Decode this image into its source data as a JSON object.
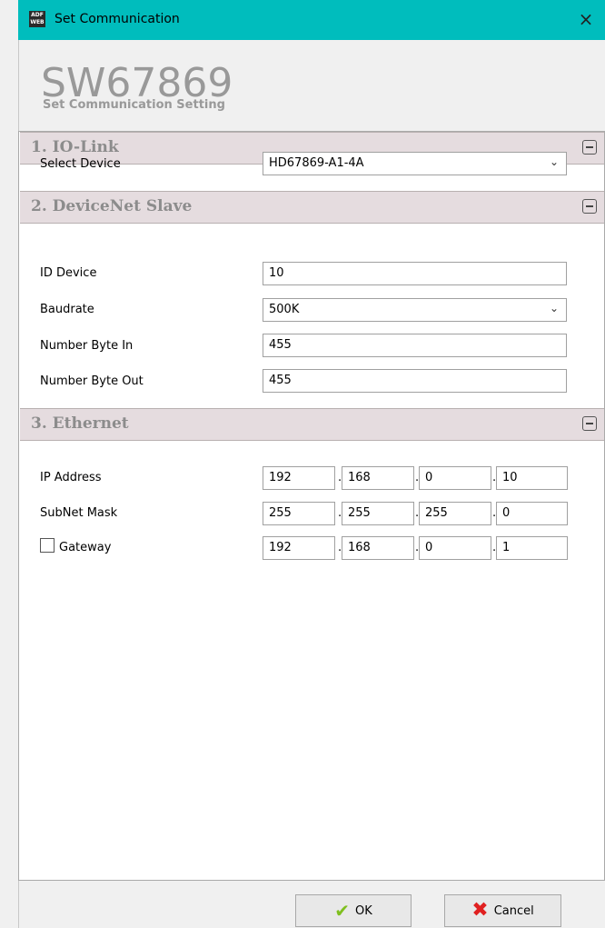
{
  "window": {
    "icon_text": "ADF WEB",
    "title": "Set Communication",
    "close": "×"
  },
  "header": {
    "model": "SW67869",
    "subtitle": "Set Communication Setting"
  },
  "sections": {
    "io_link": {
      "title": "1. IO-Link",
      "select_device_label": "Select Device",
      "select_device_value": "HD67869-A1-4A"
    },
    "devicenet": {
      "title": "2. DeviceNet Slave",
      "id_device_label": "ID Device",
      "id_device_value": "10",
      "baudrate_label": "Baudrate",
      "baudrate_value": "500K",
      "byte_in_label": "Number Byte In",
      "byte_in_value": "455",
      "byte_out_label": "Number Byte Out",
      "byte_out_value": "455"
    },
    "ethernet": {
      "title": "3. Ethernet",
      "ip_label": "IP Address",
      "ip": [
        "192",
        "168",
        "0",
        "10"
      ],
      "mask_label": "SubNet Mask",
      "mask": [
        "255",
        "255",
        "255",
        "0"
      ],
      "gateway_label": "Gateway",
      "gateway_checked": false,
      "gateway": [
        "192",
        "168",
        "0",
        "1"
      ]
    }
  },
  "buttons": {
    "ok": "OK",
    "cancel": "Cancel"
  },
  "icons": {
    "check": "✔",
    "cancel": "✖",
    "chevron": "⌄"
  },
  "colors": {
    "titlebar": "#00bdbd",
    "section_bar": "#e5dcdf",
    "ok_icon": "#7fbf1f",
    "cancel_icon": "#e02020"
  }
}
